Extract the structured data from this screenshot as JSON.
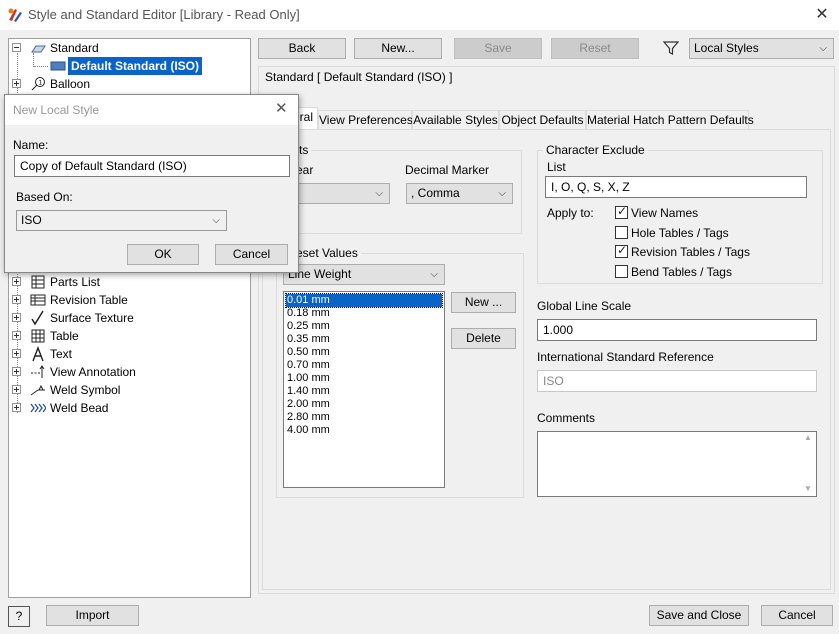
{
  "window": {
    "title": "Style and Standard Editor [Library - Read Only]",
    "close_glyph": "✕"
  },
  "toolbar": {
    "back_label": "Back",
    "new_label": "New...",
    "save_label": "Save",
    "reset_label": "Reset",
    "filter_value": "Local Styles"
  },
  "tree": {
    "items": [
      {
        "label": "Standard",
        "icon": "standard-icon"
      },
      {
        "label": "Default Standard (ISO)",
        "icon": "standard-doc-icon"
      },
      {
        "label": "Balloon",
        "icon": "balloon-icon"
      },
      {
        "label": "Parts List",
        "icon": "parts-list-icon"
      },
      {
        "label": "Revision Table",
        "icon": "revision-table-icon"
      },
      {
        "label": "Surface Texture",
        "icon": "surface-texture-icon"
      },
      {
        "label": "Table",
        "icon": "table-icon"
      },
      {
        "label": "Text",
        "icon": "text-icon"
      },
      {
        "label": "View Annotation",
        "icon": "view-annotation-icon"
      },
      {
        "label": "Weld Symbol",
        "icon": "weld-symbol-icon"
      },
      {
        "label": "Weld Bead",
        "icon": "weld-bead-icon"
      }
    ]
  },
  "standard_header": "Standard [ Default Standard (ISO) ]",
  "tabs": [
    {
      "label": "General",
      "visible_text": "eral"
    },
    {
      "label": "View Preferences"
    },
    {
      "label": "Available Styles"
    },
    {
      "label": "Object Defaults"
    },
    {
      "label": "Material Hatch Pattern Defaults"
    }
  ],
  "units": {
    "group_title_visible": "ts",
    "linear_label_visible": "ear",
    "linear_value_visible": "n",
    "decimal_marker_label": "Decimal Marker",
    "decimal_marker_value": ", Comma"
  },
  "character_exclude": {
    "title": "Character Exclude",
    "list_label": "List",
    "list_value": "I, O, Q, S, X, Z",
    "apply_to_label": "Apply to:",
    "options": [
      {
        "label": "View Names",
        "checked": true
      },
      {
        "label": "Hole Tables / Tags",
        "checked": false
      },
      {
        "label": "Revision Tables / Tags",
        "checked": true
      },
      {
        "label": "Bend Tables / Tags",
        "checked": false
      }
    ]
  },
  "preset_values": {
    "title_visible": "eset Values",
    "type_value_visible": "Line Weight",
    "items": [
      "0.01 mm",
      "0.18 mm",
      "0.25 mm",
      "0.35 mm",
      "0.50 mm",
      "0.70 mm",
      "1.00 mm",
      "1.40 mm",
      "2.00 mm",
      "2.80 mm",
      "4.00 mm"
    ],
    "selected_index": 0,
    "new_label": "New ...",
    "delete_label": "Delete"
  },
  "global_line_scale": {
    "label": "Global Line Scale",
    "value": "1.000"
  },
  "intl_standard_reference": {
    "label": "International Standard Reference",
    "value": "ISO"
  },
  "comments": {
    "label": "Comments",
    "value": ""
  },
  "dialog": {
    "title": "New Local Style",
    "name_label": "Name:",
    "name_value": "Copy of Default Standard (ISO)",
    "based_on_label": "Based On:",
    "based_on_value": "ISO",
    "ok_label": "OK",
    "cancel_label": "Cancel",
    "close_glyph": "✕"
  },
  "bottom": {
    "help_label": "?",
    "import_label": "Import",
    "save_close_label": "Save and Close",
    "cancel_label": "Cancel"
  },
  "colors": {
    "selection": "#0a64c8",
    "window_bg": "#f0f0f0"
  }
}
